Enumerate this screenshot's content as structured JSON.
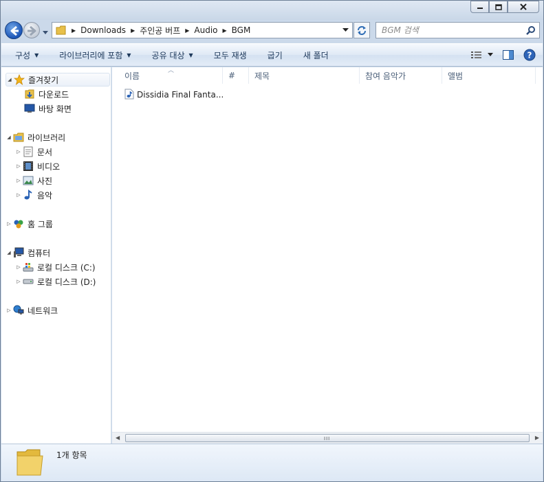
{
  "window": {
    "controls": [
      "minimize",
      "maximize",
      "close"
    ]
  },
  "navigation": {
    "back": "back-arrow",
    "forward": "forward-arrow"
  },
  "address": {
    "crumbs": [
      "Downloads",
      "주인공 버프",
      "Audio",
      "BGM"
    ]
  },
  "search": {
    "placeholder": "BGM 검색"
  },
  "toolbar": {
    "organize": "구성",
    "include_in_library": "라이브러리에 포함",
    "share_with": "공유 대상",
    "play_all": "모두 재생",
    "burn": "굽기",
    "new_folder": "새 폴더"
  },
  "sidebar": {
    "favorites": {
      "label": "즐겨찾기",
      "items": [
        "다운로드",
        "바탕 화면"
      ]
    },
    "libraries": {
      "label": "라이브러리",
      "items": [
        "문서",
        "비디오",
        "사진",
        "음악"
      ]
    },
    "homegroup": "홈 그룹",
    "computer": {
      "label": "컴퓨터",
      "items": [
        "로컬 디스크 (C:)",
        "로컬 디스크 (D:)"
      ]
    },
    "network": "네트워크"
  },
  "columns": [
    "이름",
    "#",
    "제목",
    "참여 음악가",
    "앨범"
  ],
  "files": [
    {
      "name": "Dissidia Final Fanta...",
      "icon": "audio-file-icon"
    }
  ],
  "status": {
    "item_count": "1개 항목"
  },
  "colors": {
    "frame": "#cbd9ea",
    "accent": "#1e395b",
    "back_button": "#1c56b7"
  }
}
